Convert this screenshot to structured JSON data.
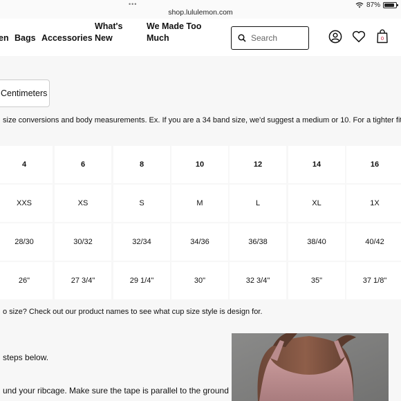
{
  "status_bar": {
    "url": "shop.lululemon.com",
    "battery": "87%"
  },
  "nav": {
    "items": [
      "en",
      "Bags",
      "Accessories",
      "What's New",
      "We Made Too Much"
    ],
    "search_placeholder": "Search",
    "cart_count": "0"
  },
  "units_button": "Centimeters",
  "intro_text": "size conversions and body measurements. Ex. If you are a 34 band size, we'd suggest a medium or 10. For a tighter fit,",
  "size_table": {
    "rows": [
      [
        "4",
        "6",
        "8",
        "10",
        "12",
        "14",
        "16"
      ],
      [
        "XXS",
        "XS",
        "S",
        "M",
        "L",
        "XL",
        "1X"
      ],
      [
        "28/30",
        "30/32",
        "32/34",
        "34/36",
        "36/38",
        "38/40",
        "40/42"
      ],
      [
        "26\"",
        "27 3/4\"",
        "29 1/4\"",
        "30\"",
        "32 3/4\"",
        "35\"",
        "37 1/8\""
      ]
    ]
  },
  "cup_question": "o size? Check out our product names to see what cup size style is design for.",
  "steps_text": "steps below.",
  "ribcage_text": "und your ribcage. Make sure the tape is parallel to the ground",
  "colors": {
    "background": "#f7f7f7",
    "cell": "#ffffff",
    "text": "#111111"
  }
}
